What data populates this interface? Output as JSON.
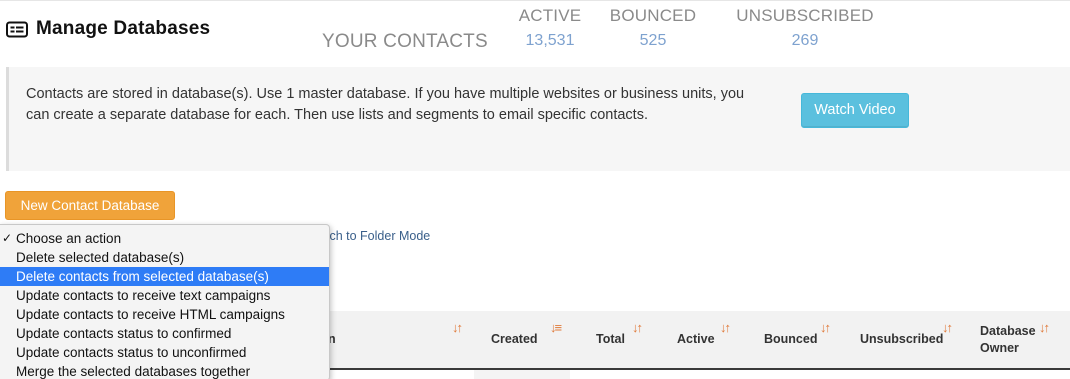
{
  "header": {
    "title": "Manage Databases",
    "title_icon": "id-card-icon",
    "contacts_label": "YOUR CONTACTS",
    "stats": {
      "active": {
        "label": "ACTIVE",
        "value": "13,531"
      },
      "bounced": {
        "label": "BOUNCED",
        "value": "525"
      },
      "unsubscribed": {
        "label": "UNSUBSCRIBED",
        "value": "269"
      }
    }
  },
  "info": {
    "text": "Contacts are stored in database(s). Use 1 master database. If you have multiple websites or business units, you can create a separate database for each. Then use lists and segments to email specific contacts.",
    "watch_video_label": "Watch Video"
  },
  "toolbar": {
    "new_database_label": "New Contact Database",
    "folder_mode_link": "tch to Folder Mode"
  },
  "action_menu": {
    "items": [
      "Choose an action",
      "Delete selected database(s)",
      "Delete contacts from selected database(s)",
      "Update contacts to receive text campaigns",
      "Update contacts to receive HTML campaigns",
      "Update contacts status to confirmed",
      "Update contacts status to unconfirmed",
      "Merge the selected databases together"
    ],
    "checked": "Choose an action",
    "highlighted": "Delete contacts from selected database(s)"
  },
  "table": {
    "name_fragment": "n",
    "columns": {
      "created": "Created",
      "total": "Total",
      "active": "Active",
      "bounced": "Bounced",
      "unsubscribed": "Unsubscribed",
      "owner_line1": "Database",
      "owner_line2": "Owner"
    },
    "sort_icon": "sort-arrows-icon"
  },
  "colors": {
    "accent_blue": "#5bc0de",
    "accent_orange": "#f0a33a",
    "stat_value": "#7ea2cf",
    "selection": "#2e7cf6",
    "sort_icon": "#e07a3a"
  }
}
